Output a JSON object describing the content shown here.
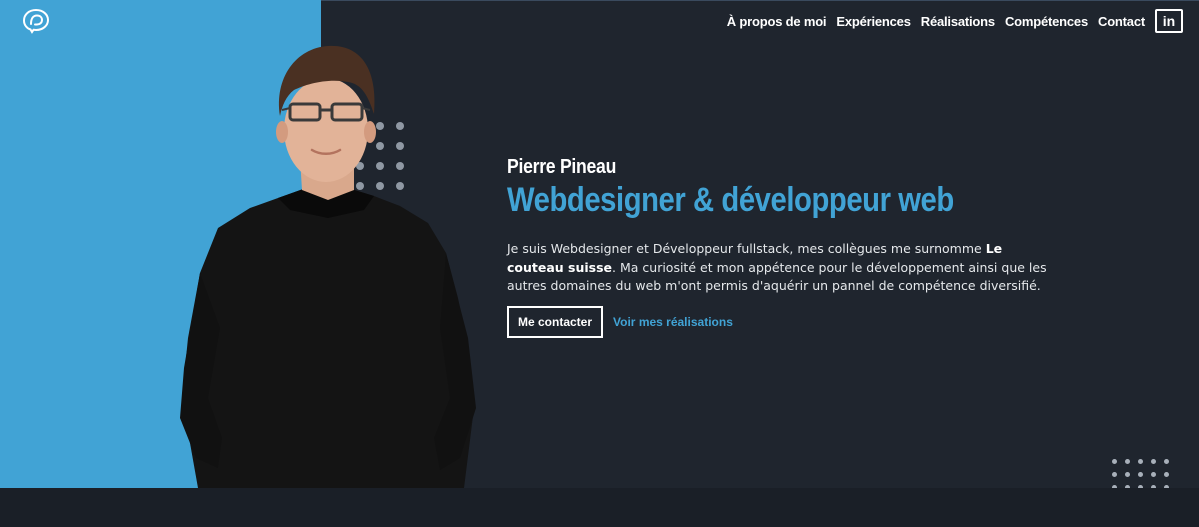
{
  "nav": {
    "items": [
      {
        "label": "À propos de moi"
      },
      {
        "label": "Expériences"
      },
      {
        "label": "Réalisations"
      },
      {
        "label": "Compétences"
      },
      {
        "label": "Contact"
      }
    ],
    "linkedin_label": "in"
  },
  "hero": {
    "name": "Pierre Pineau",
    "title": "Webdesigner & développeur web",
    "intro_before": "Je suis Webdesigner et Développeur fullstack, mes collègues me surnomme ",
    "intro_bold": "Le couteau suisse",
    "intro_after": ". Ma curiosité et mon appétence pour le développement ainsi que les autres domaines du web m'ont permis d'aquérir un pannel de compétence diversifié.",
    "contact_button": "Me contacter",
    "works_link": "Voir mes réalisations"
  },
  "icons": {
    "logo": "logo-icon",
    "linkedin": "linkedin-icon"
  },
  "colors": {
    "accent": "#41a3d5",
    "background": "#1f252e",
    "bottom_band": "#1a1f27"
  }
}
